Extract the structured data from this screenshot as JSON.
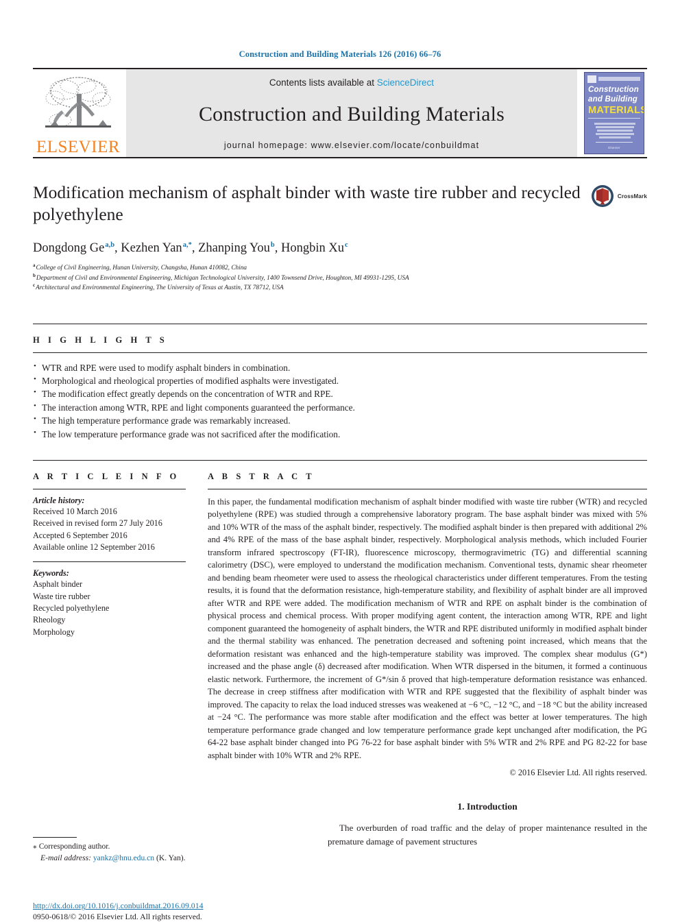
{
  "running_head": "Construction and Building Materials 126 (2016) 66–76",
  "masthead": {
    "publisher_logo_text": "ELSEVIER",
    "contents_prefix": "Contents lists available at",
    "sciencedirect": "ScienceDirect",
    "journal_title": "Construction and Building Materials",
    "homepage_line": "journal homepage: www.elsevier.com/locate/conbuildmat",
    "cover": {
      "line1": "Construction",
      "line2": "and Building",
      "line3": "MATERIALS",
      "foot": "Elsevier"
    }
  },
  "article": {
    "title": "Modification mechanism of asphalt binder with waste tire rubber and recycled polyethylene",
    "crossmark_label": "CrossMark",
    "authors": [
      {
        "name": "Dongdong Ge",
        "sup": "a,b",
        "sep": ", "
      },
      {
        "name": "Kezhen Yan",
        "sup": "a,*",
        "sep": ", "
      },
      {
        "name": "Zhanping You",
        "sup": "b",
        "sep": ", "
      },
      {
        "name": "Hongbin Xu",
        "sup": "c",
        "sep": ""
      }
    ],
    "affiliations": [
      {
        "mark": "a",
        "text": "College of Civil Engineering, Hunan University, Changsha, Hunan 410082, China"
      },
      {
        "mark": "b",
        "text": "Department of Civil and Environmental Engineering, Michigan Technological University, 1400 Townsend Drive, Houghton, MI 49931-1295, USA"
      },
      {
        "mark": "c",
        "text": "Architectural and Environmental Engineering, The University of Texas at Austin, TX 78712, USA"
      }
    ]
  },
  "highlights": {
    "label": "H I G H L I G H T S",
    "items": [
      "WTR and RPE were used to modify asphalt binders in combination.",
      "Morphological and rheological properties of modified asphalts were investigated.",
      "The modification effect greatly depends on the concentration of WTR and RPE.",
      "The interaction among WTR, RPE and light components guaranteed the performance.",
      "The high temperature performance grade was remarkably increased.",
      "The low temperature performance grade was not sacrificed after the modification."
    ]
  },
  "article_info": {
    "label": "A R T I C L E   I N F O",
    "history_heading": "Article history:",
    "history": [
      "Received 10 March 2016",
      "Received in revised form 27 July 2016",
      "Accepted 6 September 2016",
      "Available online 12 September 2016"
    ],
    "keywords_heading": "Keywords:",
    "keywords": [
      "Asphalt binder",
      "Waste tire rubber",
      "Recycled polyethylene",
      "Rheology",
      "Morphology"
    ]
  },
  "abstract": {
    "label": "A B S T R A C T",
    "text": "In this paper, the fundamental modification mechanism of asphalt binder modified with waste tire rubber (WTR) and recycled polyethylene (RPE) was studied through a comprehensive laboratory program. The base asphalt binder was mixed with 5% and 10% WTR of the mass of the asphalt binder, respectively. The modified asphalt binder is then prepared with additional 2% and 4% RPE of the mass of the base asphalt binder, respectively. Morphological analysis methods, which included Fourier transform infrared spectroscopy (FT-IR), fluorescence microscopy, thermogravimetric (TG) and differential scanning calorimetry (DSC), were employed to understand the modification mechanism. Conventional tests, dynamic shear rheometer and bending beam rheometer were used to assess the rheological characteristics under different temperatures. From the testing results, it is found that the deformation resistance, high-temperature stability, and flexibility of asphalt binder are all improved after WTR and RPE were added. The modification mechanism of WTR and RPE on asphalt binder is the combination of physical process and chemical process. With proper modifying agent content, the interaction among WTR, RPE and light component guaranteed the homogeneity of asphalt binders, the WTR and RPE distributed uniformly in modified asphalt binder and the thermal stability was enhanced. The penetration decreased and softening point increased, which means that the deformation resistant was enhanced and the high-temperature stability was improved. The complex shear modulus (G*) increased and the phase angle (δ) decreased after modification. When WTR dispersed in the bitumen, it formed a continuous elastic network. Furthermore, the increment of G*/sin δ proved that high-temperature deformation resistance was enhanced. The decrease in creep stiffness after modification with WTR and RPE suggested that the flexibility of asphalt binder was improved. The capacity to relax the load induced stresses was weakened at −6 °C, −12 °C, and −18 °C but the ability increased at −24 °C. The performance was more stable after modification and the effect was better at lower temperatures. The high temperature performance grade changed and low temperature performance grade kept unchanged after modification, the PG 64-22 base asphalt binder changed into PG 76-22 for base asphalt binder with 5% WTR and 2% RPE and PG 82-22 for base asphalt binder with 10% WTR and 2% RPE.",
    "copyright": "© 2016 Elsevier Ltd. All rights reserved."
  },
  "introduction": {
    "heading": "1. Introduction",
    "paragraph": "The overburden of road traffic and the delay of proper maintenance resulted in the premature damage of pavement structures"
  },
  "footer": {
    "corresponding_mark": "⁎",
    "corresponding_text": "Corresponding author.",
    "email_label": "E-mail address:",
    "email": "yankz@hnu.edu.cn",
    "email_suffix": "(K. Yan).",
    "doi": "http://dx.doi.org/10.1016/j.conbuildmat.2016.09.014",
    "issn_line": "0950-0618/© 2016 Elsevier Ltd. All rights reserved."
  },
  "colors": {
    "link": "#1a72a8",
    "sciencedirect": "#1a9ad4",
    "elsevier_orange": "#f58220",
    "cover_bg": "#7c86c4",
    "cover_yellow": "#f5e03c",
    "masthead_band": "#e6e6e6"
  }
}
